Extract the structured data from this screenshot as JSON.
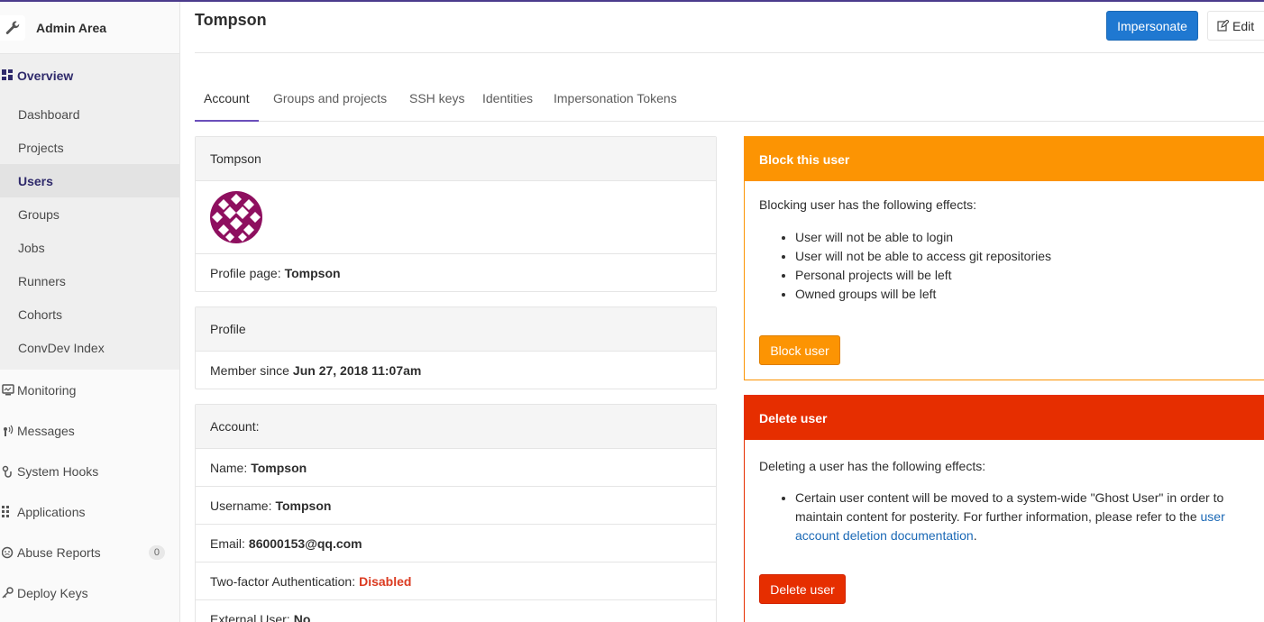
{
  "sidebar": {
    "title": "Admin Area",
    "overview": "Overview",
    "sub_items": [
      "Dashboard",
      "Projects",
      "Users",
      "Groups",
      "Jobs",
      "Runners",
      "Cohorts",
      "ConvDev Index"
    ],
    "active_sub": "Users",
    "sections": [
      {
        "label": "Monitoring",
        "icon": "monitor-icon"
      },
      {
        "label": "Messages",
        "icon": "broadcast-icon"
      },
      {
        "label": "System Hooks",
        "icon": "hook-icon"
      },
      {
        "label": "Applications",
        "icon": "grid-icon"
      },
      {
        "label": "Abuse Reports",
        "icon": "abuse-icon",
        "count": "0"
      },
      {
        "label": "Deploy Keys",
        "icon": "key-icon"
      }
    ]
  },
  "header": {
    "title": "Tompson",
    "impersonate_label": "Impersonate",
    "edit_label": "Edit"
  },
  "tabs": [
    "Account",
    "Groups and projects",
    "SSH keys",
    "Identities",
    "Impersonation Tokens"
  ],
  "active_tab": "Account",
  "user_card": {
    "header": "Tompson",
    "profile_page_label": "Profile page:",
    "profile_page_value": "Tompson"
  },
  "profile_card": {
    "header": "Profile",
    "member_since_label": "Member since",
    "member_since_value": "Jun 27, 2018 11:07am"
  },
  "account_card": {
    "header": "Account:",
    "rows": [
      {
        "label": "Name:",
        "value": "Tompson"
      },
      {
        "label": "Username:",
        "value": "Tompson"
      },
      {
        "label": "Email:",
        "value": "86000153@qq.com"
      },
      {
        "label": "Two-factor Authentication:",
        "value": "Disabled"
      },
      {
        "label": "External User:",
        "value": "No"
      }
    ]
  },
  "block_card": {
    "header": "Block this user",
    "intro": "Blocking user has the following effects:",
    "effects": [
      "User will not be able to login",
      "User will not be able to access git repositories",
      "Personal projects will be left",
      "Owned groups will be left"
    ],
    "button": "Block user"
  },
  "delete_card": {
    "header": "Delete user",
    "intro": "Deleting a user has the following effects:",
    "effect_line1": "Certain user content will be moved to a system-wide \"Ghost User\" in order to",
    "effect_line2": "maintain content for posterity. For further information, please refer to the",
    "link_part1": "user",
    "link_part2": "account deletion documentation",
    "effect_end": ".",
    "button": "Delete user"
  },
  "colors": {
    "accent": "#1f78d1",
    "warning": "#fc9403",
    "danger": "#e62e00",
    "active_nav": "#2f2a6b"
  }
}
